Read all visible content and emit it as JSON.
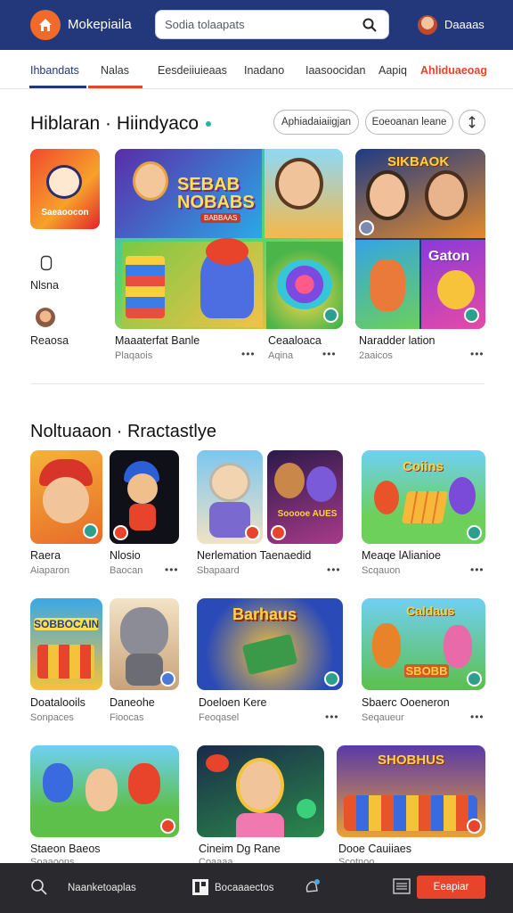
{
  "header": {
    "app_name": "Mokepiaila",
    "search_placeholder": "Sodia tolaapats",
    "user_name": "Daaaas"
  },
  "tabs": [
    {
      "label": "Ihbandats",
      "active": true,
      "color": "#23387a"
    },
    {
      "label": "Nalas",
      "active": true,
      "color": "#e8432b"
    },
    {
      "label": "Eesdeiiuieaas",
      "active": false
    },
    {
      "label": "Inadano",
      "active": false
    },
    {
      "label": "Iaasoocidan",
      "active": false
    },
    {
      "label": "Aapiq",
      "active": false
    },
    {
      "label": "Ahliduaeoag",
      "active": false,
      "color": "#e8432b"
    }
  ],
  "section1": {
    "title": "Hiblaran · Hiindyaco",
    "filter_1": "Aphiadaiaiigjan",
    "filter_2": "Eoeoanan leane",
    "side_items": [
      {
        "label": "Saeaoocon"
      },
      {
        "label": "Nlsna"
      },
      {
        "label": "Reaosa"
      }
    ],
    "cards": [
      {
        "title": "Maaaterfat Banle",
        "sub": "Plaqaois"
      },
      {
        "title": "Ceaaloaca",
        "sub": "Aqina"
      },
      {
        "title": "Naradder lation",
        "sub": "2aaicos"
      }
    ],
    "art_text": {
      "main": "SEBAB NOBABS",
      "main_small": "BABBAAS",
      "right_top": "SIKBAOK",
      "right_bottom": "Gaton"
    }
  },
  "section2": {
    "title": "Noltuaaon · Rractastlye",
    "row1": [
      {
        "title": "Raera",
        "sub": "Aiaparon"
      },
      {
        "title": "Nlosio",
        "sub": "Baocan"
      },
      {
        "title": "Nerlemation Taenaedid",
        "sub": "Sbapaard"
      },
      {
        "title": "Meaqe lAlianioe",
        "sub": "Scqauon"
      }
    ],
    "row2": [
      {
        "title": "Doatalooils",
        "sub": "Sonpaces"
      },
      {
        "title": "Daneohe",
        "sub": "Fioocas"
      },
      {
        "title": "Doeloen Kere",
        "sub": "Feoqasel"
      },
      {
        "title": "Sbaerc Ooeneron",
        "sub": "Seqaueur"
      }
    ],
    "row3": [
      {
        "title": "Staeon Baeos",
        "sub": "Soaaoons"
      },
      {
        "title": "Cineim Dg Rane",
        "sub": "Coaaaa"
      },
      {
        "title": "Dooe Cauiiaes",
        "sub": "Scotnoo"
      }
    ],
    "art_text": {
      "a": "Coiins",
      "b": "Sooooe AUES",
      "c": "SOBBOCAIN",
      "d": "Barhaus",
      "e": "Caldaus",
      "f": "SBOBB",
      "g": "SHOBHUS"
    }
  },
  "bottom_bar": {
    "item_1": "Naanketoaplas",
    "item_2": "Bocaaaectos",
    "cta": "Eeapiar"
  },
  "colors": {
    "header_bg": "#23387a",
    "accent": "#e8432b",
    "bottom_bg": "#2a2a2e"
  }
}
